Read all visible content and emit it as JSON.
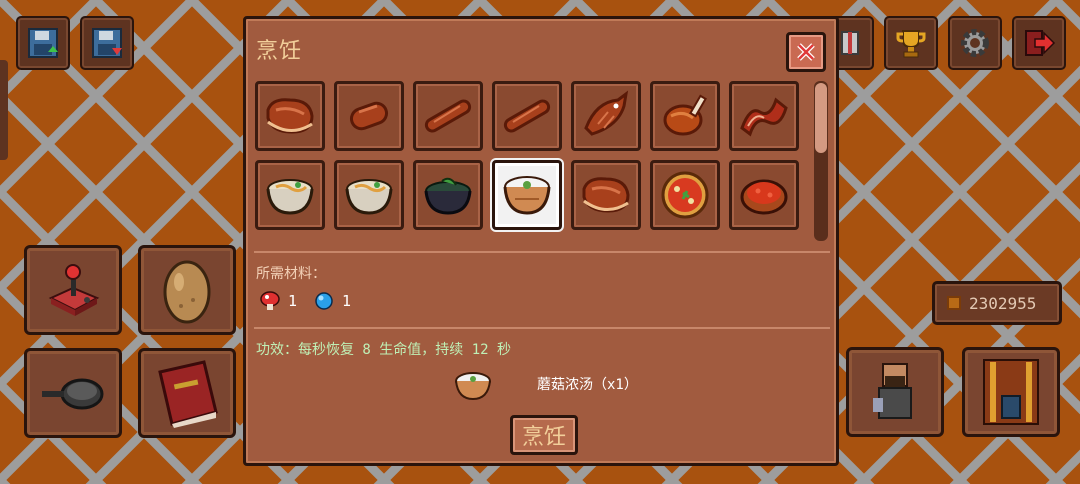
{
  "hud": {
    "top_left": [
      {
        "name": "save-game-icon"
      },
      {
        "name": "save-download-icon"
      }
    ],
    "top_right": [
      {
        "name": "gift-icon"
      },
      {
        "name": "trophy-icon"
      },
      {
        "name": "gear-icon"
      },
      {
        "name": "exit-icon"
      }
    ],
    "coins": "2302955"
  },
  "dialog": {
    "title": "烹饪",
    "recipes_row1": [
      "steak-icon",
      "sausage-icon",
      "sausage-long-icon",
      "sausage-long-icon",
      "fish-icon",
      "roast-chicken-icon",
      "bacon-icon"
    ],
    "recipes_row2": [
      "noodle-bowl-icon",
      "noodle-bowl-icon",
      "dark-soup-icon",
      "mushroom-soup-icon",
      "steak-icon",
      "pizza-icon",
      "tomato-pie-icon"
    ],
    "selected_index": 10,
    "materials_label": "所需材料：",
    "ingredients": [
      {
        "icon": "red-mushroom-icon",
        "count": "1",
        "color": "#e03030"
      },
      {
        "icon": "blue-gem-icon",
        "count": "1",
        "color": "#2aa0e8"
      }
    ],
    "effect": "功效：每秒恢复 8 生命值，持续 12 秒",
    "result": "蘑菇浓汤（x1）",
    "cook_label": "烹饪"
  }
}
